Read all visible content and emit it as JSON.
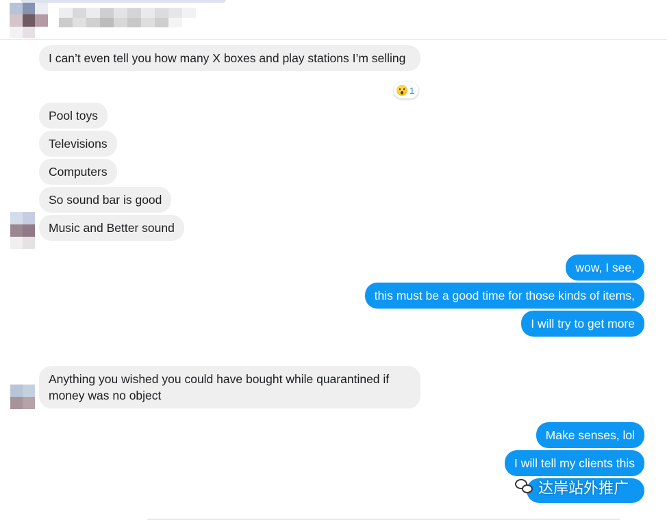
{
  "conversation": {
    "incoming_group1": [
      "I can’t even tell you how many X boxes and play stations I’m selling"
    ],
    "reaction": {
      "emoji": "astonished-face",
      "count": "1"
    },
    "incoming_group2": [
      "Pool toys",
      "Televisions",
      "Computers",
      "So sound bar is good",
      "Music and Better sound"
    ],
    "outgoing_group1": [
      "wow, I see,",
      "this must be a good time for those kinds of items,",
      "I will try to get more"
    ],
    "incoming_group3": [
      "Anything you wished you could have bought while quarantined if money was no object"
    ],
    "outgoing_group2": [
      "Make senses, lol",
      "I will tell my clients this"
    ]
  },
  "watermark": {
    "text": "达岸站外推广",
    "icon": "wechat-icon"
  },
  "colors": {
    "outgoing_bubble": "#0d96f2",
    "incoming_bubble": "#efefef",
    "reaction_count": "#0d96f2"
  }
}
